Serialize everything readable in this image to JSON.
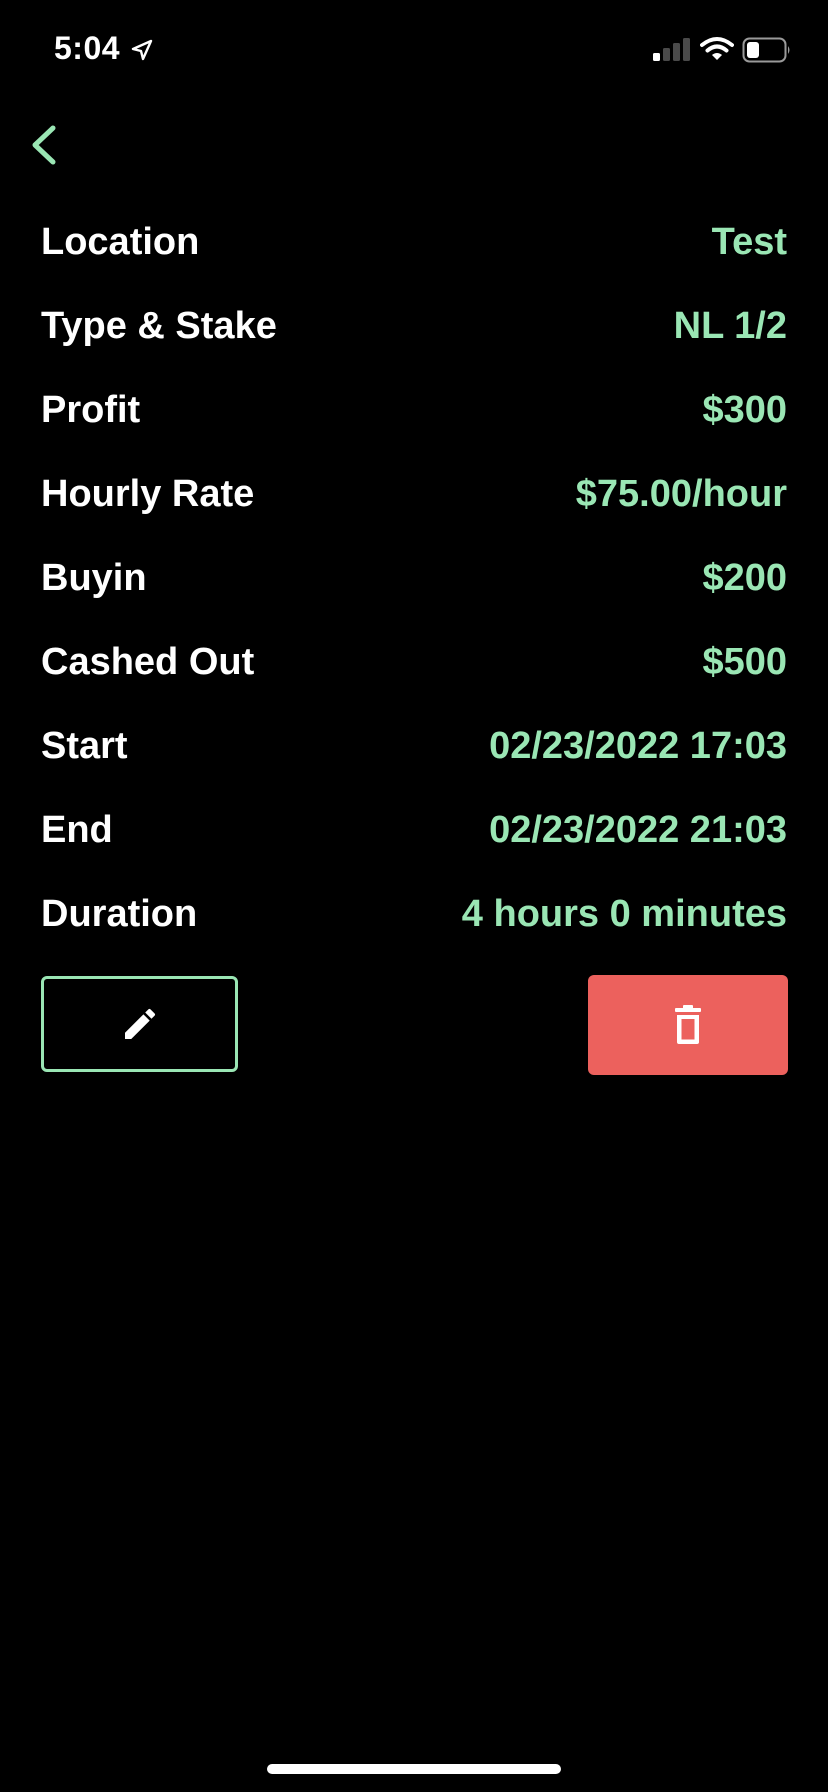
{
  "status_bar": {
    "time": "5:04",
    "icons": [
      "location-arrow-icon",
      "signal-icon",
      "wifi-icon",
      "battery-icon"
    ]
  },
  "navigation": {
    "back_icon": "chevron-left-icon"
  },
  "details": [
    {
      "label": "Location",
      "value": "Test"
    },
    {
      "label": "Type & Stake",
      "value": "NL 1/2"
    },
    {
      "label": "Profit",
      "value": "$300"
    },
    {
      "label": "Hourly Rate",
      "value": "$75.00/hour"
    },
    {
      "label": "Buyin",
      "value": "$200"
    },
    {
      "label": "Cashed Out",
      "value": "$500"
    },
    {
      "label": "Start",
      "value": "02/23/2022 17:03"
    },
    {
      "label": "End",
      "value": "02/23/2022 21:03"
    },
    {
      "label": "Duration",
      "value": "4 hours 0 minutes"
    }
  ],
  "actions": {
    "edit_icon": "pencil-icon",
    "delete_icon": "trash-icon"
  },
  "colors": {
    "background": "#000000",
    "accent": "#9ae6b4",
    "label": "#ffffff",
    "danger": "#ec615d"
  }
}
